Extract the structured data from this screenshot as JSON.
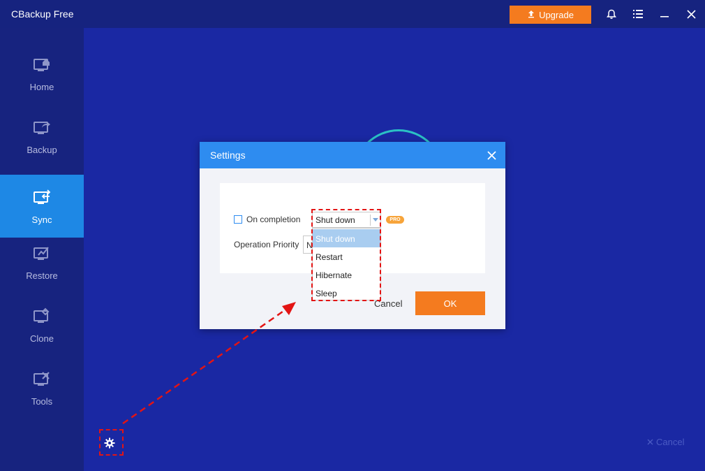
{
  "app": {
    "title": "CBackup Free",
    "upgrade_label": "Upgrade"
  },
  "titlebar_icons": [
    "bell-icon",
    "menu-icon",
    "minimize-icon",
    "close-icon"
  ],
  "sidebar": {
    "items": [
      {
        "label": "Home",
        "icon": "home-monitor-icon",
        "active": false
      },
      {
        "label": "Backup",
        "icon": "backup-monitor-icon",
        "active": false
      },
      {
        "label": "Sync",
        "icon": "sync-monitor-icon",
        "active": true
      },
      {
        "label": "Restore",
        "icon": "restore-monitor-icon",
        "active": false
      },
      {
        "label": "Clone",
        "icon": "clone-monitor-icon",
        "active": false
      },
      {
        "label": "Tools",
        "icon": "tools-monitor-icon",
        "active": false
      }
    ]
  },
  "main": {
    "cancel_label": "Cancel"
  },
  "dialog": {
    "title": "Settings",
    "on_completion_label": "On completion",
    "on_completion_checked": false,
    "selected_action": "Shut down",
    "pro_badge": "PRO",
    "priority_label": "Operation Priority",
    "priority_value": "N",
    "options": [
      "Shut down",
      "Restart",
      "Hibernate",
      "Sleep"
    ],
    "cancel_label": "Cancel",
    "ok_label": "OK"
  },
  "colors": {
    "accent_blue": "#2e8cf0",
    "upgrade_orange": "#f47b1f",
    "sidebar_bg": "#17237f",
    "main_bg": "#1a28a3",
    "annotation_red": "#e31414"
  }
}
